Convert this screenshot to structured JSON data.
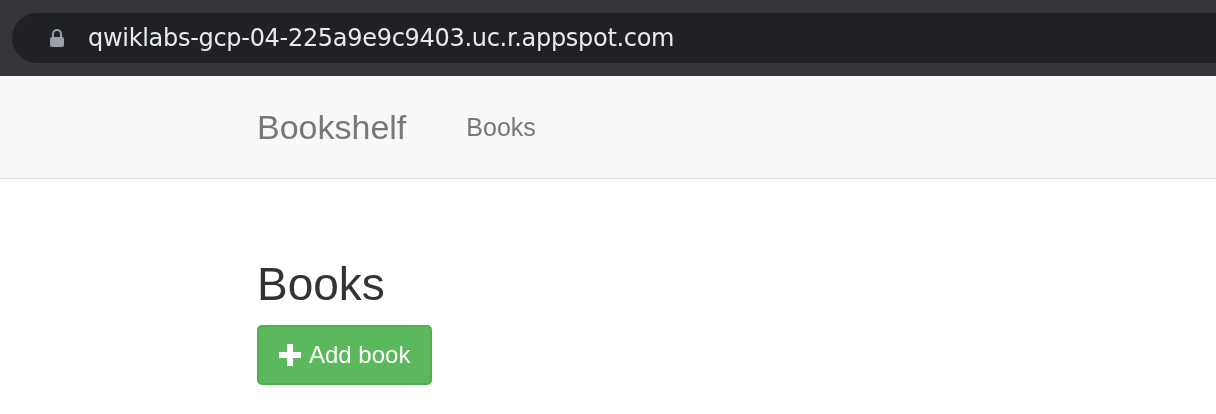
{
  "browser": {
    "url": "qwiklabs-gcp-04-225a9e9c9403.uc.r.appspot.com"
  },
  "navbar": {
    "brand": "Bookshelf",
    "links": [
      {
        "label": "Books",
        "selected": false
      }
    ]
  },
  "page": {
    "heading": "Books",
    "buttons": [
      {
        "kind": "add",
        "label": "Add book"
      }
    ]
  }
}
